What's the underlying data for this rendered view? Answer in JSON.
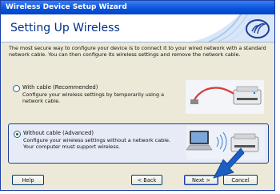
{
  "window": {
    "title": "Wireless Device Setup Wizard"
  },
  "header": {
    "heading": "Setting Up Wireless"
  },
  "description": "The most secure way to configure your device is to connect it to your wired network with a standard network cable. You can then configure its wireless settings and remove the network cable.",
  "options": [
    {
      "label": "With cable (Recommended)",
      "description": "Configure your wireless settings by temporarily using a network cable.",
      "selected": false
    },
    {
      "label": "Without cable (Advanced)",
      "description_line1": "Configure your wireless settings without a network cable.",
      "description_line2": "Your computer must support wireless.",
      "selected": true
    }
  ],
  "buttons": {
    "help": "Help",
    "back": "< Back",
    "next": "Next >",
    "cancel": "Cancel"
  },
  "colors": {
    "titlebar": "#0a54dd",
    "heading": "#00318c",
    "selection_border": "#1f3f9c",
    "arrow": "#1b5fc4"
  },
  "icons": [
    "wireless-logo-icon",
    "printer-cable-illustration",
    "laptop-wireless-printer-illustration",
    "pointer-arrow"
  ]
}
